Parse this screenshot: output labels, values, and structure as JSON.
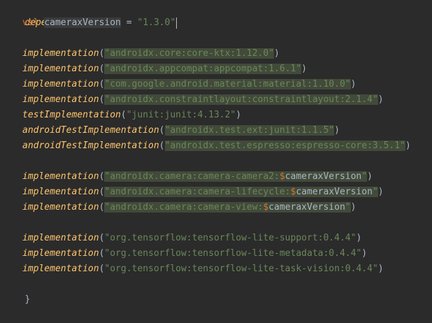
{
  "editor": {
    "block_open": "dependencies {",
    "val_kw": "val",
    "val_name": "cameraxVersion",
    "val_eq": " = ",
    "val_value": "\"1.3.0\"",
    "lines": [
      {
        "fn": "implementation",
        "arg": "\"androidx.core:core-ktx:1.12.0\"",
        "hl": true
      },
      {
        "fn": "implementation",
        "arg": "\"androidx.appcompat:appcompat:1.6.1\"",
        "hl": true
      },
      {
        "fn": "implementation",
        "arg": "\"com.google.android.material:material:1.10.0\"",
        "hl": true
      },
      {
        "fn": "implementation",
        "arg": "\"androidx.constraintlayout:constraintlayout:2.1.4\"",
        "hl": true
      },
      {
        "fn": "testImplementation",
        "arg": "\"junit:junit:4.13.2\"",
        "hl": false
      },
      {
        "fn": "androidTestImplementation",
        "arg": "\"androidx.test.ext:junit:1.1.5\"",
        "hl": true
      },
      {
        "fn": "androidTestImplementation",
        "arg": "\"androidx.test.espresso:espresso-core:3.5.1\"",
        "hl": true
      }
    ],
    "camera_lines": [
      {
        "fn": "implementation",
        "prefix": "\"androidx.camera:camera-camera2:",
        "var": "cameraxVersion",
        "suffix": "\""
      },
      {
        "fn": "implementation",
        "prefix": "\"androidx.camera:camera-lifecycle:",
        "var": "cameraxVersion",
        "suffix": "\""
      },
      {
        "fn": "implementation",
        "prefix": "\"androidx.camera:camera-view:",
        "var": "cameraxVersion",
        "suffix": "\""
      }
    ],
    "tf_lines": [
      {
        "fn": "implementation",
        "arg": "\"org.tensorflow:tensorflow-lite-support:0.4.4\""
      },
      {
        "fn": "implementation",
        "arg": "\"org.tensorflow:tensorflow-lite-metadata:0.4.4\""
      },
      {
        "fn": "implementation",
        "arg": "\"org.tensorflow:tensorflow-lite-task-vision:0.4.4\""
      }
    ],
    "template_sign": "$",
    "paren_open": "(",
    "paren_close": ")",
    "block_close": "}"
  }
}
